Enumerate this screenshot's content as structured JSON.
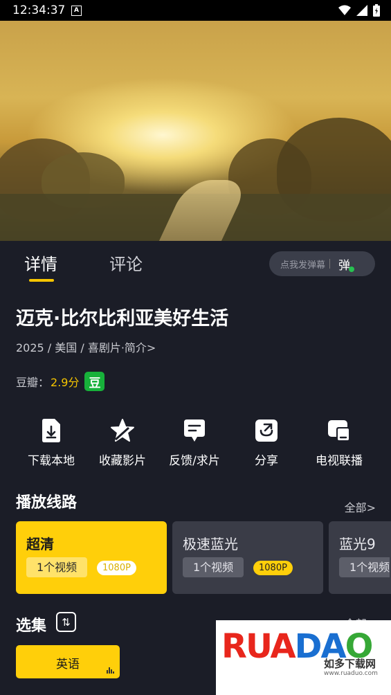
{
  "status_bar": {
    "time": "12:34:37",
    "notification_icon": "A"
  },
  "tabs": [
    {
      "label": "详情",
      "active": true
    },
    {
      "label": "评论",
      "active": false
    }
  ],
  "danmu": {
    "placeholder": "点我发弹幕",
    "icon_text": "弹"
  },
  "movie": {
    "title": "迈克·比尔比利亚美好生活",
    "meta": "2025 / 美国 / 喜剧片·简介>",
    "rating_label": "豆瓣：",
    "rating_score": "2.9分",
    "rating_badge": "豆"
  },
  "actions": [
    {
      "label": "下载本地",
      "icon": "download-icon"
    },
    {
      "label": "收藏影片",
      "icon": "star-icon"
    },
    {
      "label": "反馈/求片",
      "icon": "feedback-icon"
    },
    {
      "label": "分享",
      "icon": "share-icon"
    },
    {
      "label": "电视联播",
      "icon": "tv-cast-icon"
    }
  ],
  "lines_section": {
    "title": "播放线路",
    "more": "全部>",
    "lines": [
      {
        "name": "超清",
        "count": "1个视频",
        "quality": "1080P",
        "active": true
      },
      {
        "name": "极速蓝光",
        "count": "1个视频",
        "quality": "1080P",
        "active": false
      },
      {
        "name": "蓝光9",
        "count": "1个视频",
        "quality": "",
        "active": false
      }
    ]
  },
  "episodes_section": {
    "title": "选集",
    "sort_icon": "sort-toggle-icon",
    "more": "全部>",
    "episodes": [
      {
        "label": "英语",
        "playing": true
      }
    ]
  },
  "watermark": {
    "logo": "RUANDAO",
    "cn": "如多下载网",
    "url": "www.ruaduo.com"
  },
  "colors": {
    "accent": "#ffcf0a",
    "background": "#1b1d27",
    "rating_green": "#17b13a"
  }
}
